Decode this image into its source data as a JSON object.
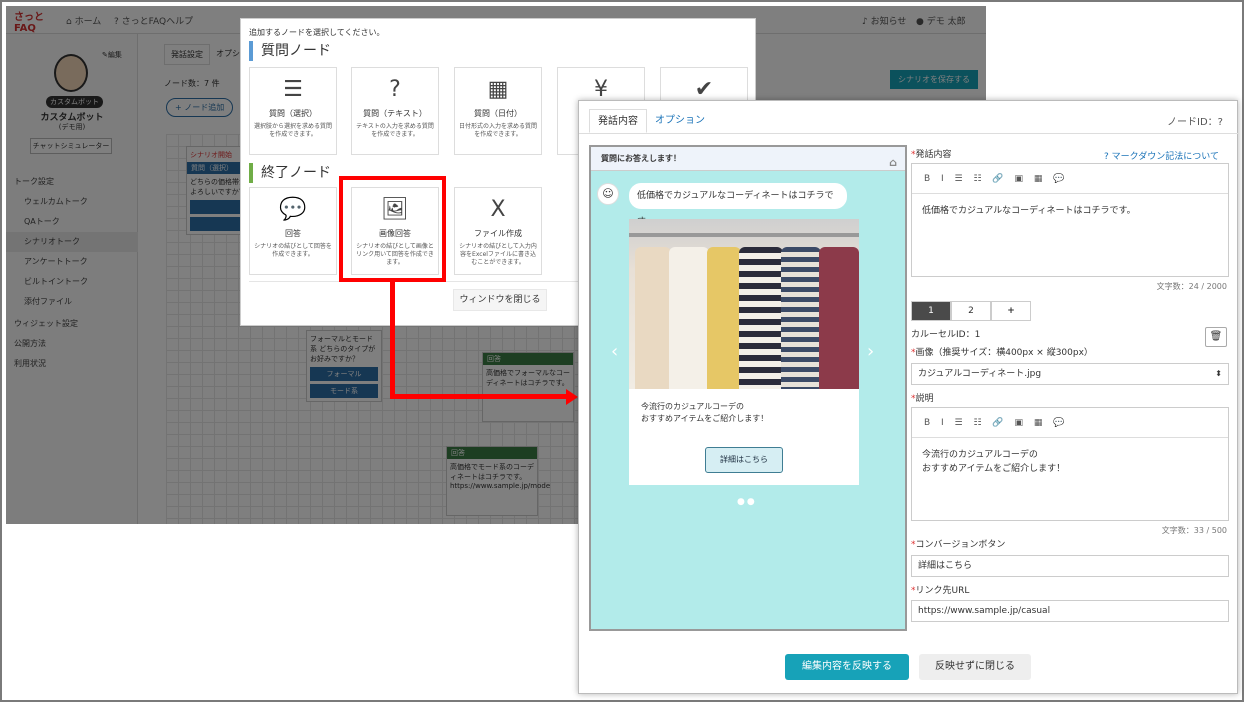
{
  "app": {
    "logo": "さっとFAQ",
    "nav_home": "ホーム",
    "nav_help": "さっとFAQヘルプ",
    "nav_notice": "お知らせ",
    "nav_user": "デモ 太郎",
    "tab_scenario": "発話設定",
    "tab_option": "オプシ",
    "node_count": "ノード数：7 件",
    "add_node": "ノード追加",
    "save_scenario": "シナリオを保存する",
    "sidebar": {
      "edit": "編集",
      "bot_badge": "カスタムボット",
      "bot_name": "カスタムボット",
      "bot_sub": "(デモ用)",
      "simulator": "チャットシミュレーター",
      "sections": [
        "トーク設定",
        "ウィジェット設定",
        "公開方法",
        "利用状況"
      ],
      "items": [
        "ウェルカムトーク",
        "QAトーク",
        "シナリオトーク",
        "アンケートトーク",
        "ビルトイントーク",
        "添付ファイル"
      ]
    },
    "bg_nodes": {
      "start": "シナリオ開始",
      "q1_hdr": "質問（選択）",
      "q1_text": "どちらの価格帯がよろしいですか？",
      "q2_text": "フォーマルとモード系 どちらのタイプがお好みですか？",
      "btn_formal": "フォーマル",
      "btn_mode": "モード系",
      "ans1_hdr": "回答",
      "ans1_text": "高価格でフォーマルなコーディネートはコチラです。",
      "ans2_hdr": "回答",
      "ans2_text": "高価格でモード系のコーディネートはコチラです。 https://www.sample.jp/mode"
    }
  },
  "node_dialog": {
    "hint": "追加するノードを選択してください。",
    "question_section": "質問ノード",
    "end_section": "終了ノード",
    "question_cards": [
      {
        "icon": "☰",
        "title": "質問（選択）",
        "desc": "選択肢から選択を求める質問を作成できます。"
      },
      {
        "icon": "?",
        "title": "質問（テキスト）",
        "desc": "テキストの入力を求める質問を作成できます。"
      },
      {
        "icon": "▦",
        "title": "質問（日付）",
        "desc": "日付形式の入力を求める質問を作成できます。"
      },
      {
        "icon": "¥",
        "title": "",
        "desc": ""
      },
      {
        "icon": "✔",
        "title": "",
        "desc": ""
      }
    ],
    "end_cards": [
      {
        "icon": "💬",
        "title": "回答",
        "desc": "シナリオの結びとして回答を作成できます。"
      },
      {
        "icon": "🖼",
        "title": "画像回答",
        "desc": "シナリオの結びとして画像とリンク用いて回答を作成できます。"
      },
      {
        "icon": "X",
        "title": "ファイル作成",
        "desc": "シナリオの結びとして入力内容をExcelファイルに書き込むことができます。"
      }
    ],
    "close_button": "ウィンドウを閉じる"
  },
  "editor": {
    "tab_content": "発話内容",
    "tab_option": "オプション",
    "node_id": "ノードID：?",
    "preview": {
      "header": "質問にお答えします！",
      "bubble": "低価格でカジュアルなコーディネートはコチラです。",
      "card_desc_1": "今流行のカジュアルコーデの",
      "card_desc_2": "おすすめアイテムをご紹介します！",
      "card_button": "詳細はこちら",
      "dots": "●●"
    },
    "utterance_label": "発話内容",
    "markdown_link": "マークダウン記法について",
    "utterance_text": "低価格でカジュアルなコーディネートはコチラです。",
    "utterance_count": "文字数：24 / 2000",
    "toolbar": "B I ☰ ☷ 🔗 ▣ ▦ 💬",
    "carousel_tabs": [
      "1",
      "2",
      "+"
    ],
    "carousel_id": "カルーセルID：1",
    "image_label": "画像（推奨サイズ：横400px × 縦300px）",
    "image_value": "カジュアルコーディネート.jpg",
    "desc_label": "説明",
    "desc_text_1": "今流行のカジュアルコーデの",
    "desc_text_2": "おすすめアイテムをご紹介します！",
    "desc_count": "文字数：33 / 500",
    "conversion_label": "コンバージョンボタン",
    "conversion_value": "詳細はこちら",
    "url_label": "リンク先URL",
    "url_value": "https://www.sample.jp/casual",
    "apply_button": "編集内容を反映する",
    "cancel_button": "反映せずに閉じる",
    "required_mark": "*"
  },
  "colors": {
    "accent": "#17a2b8",
    "highlight": "#ff0000",
    "preview_bg": "#b2ebea"
  }
}
